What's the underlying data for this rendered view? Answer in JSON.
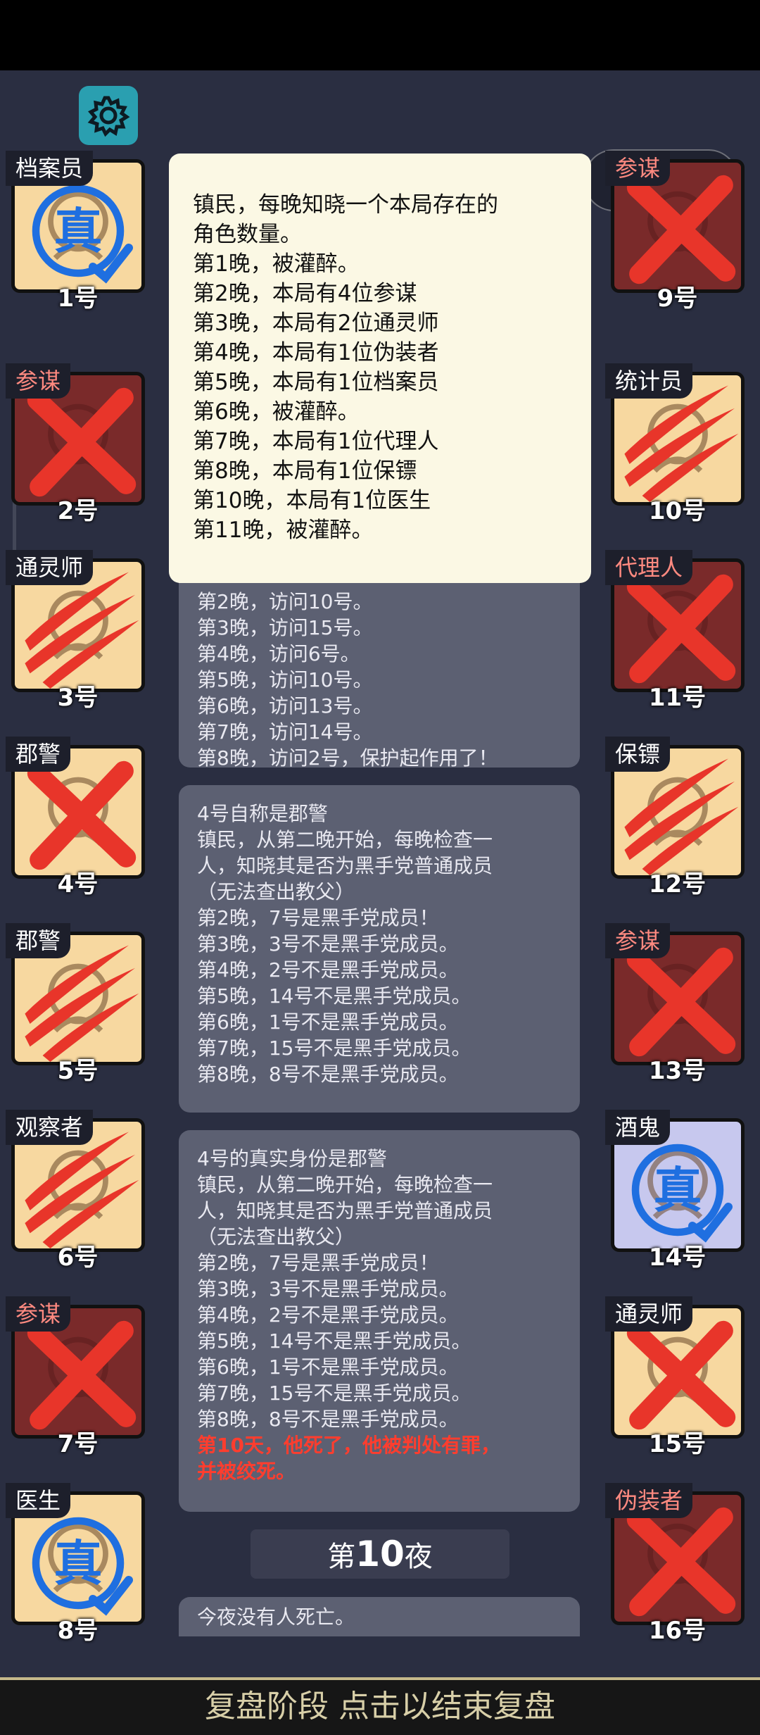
{
  "players_left": [
    {
      "num": "1号",
      "role": "档案员",
      "role_color": "white",
      "state": "true-seal"
    },
    {
      "num": "2号",
      "role": "参谋",
      "role_color": "red",
      "state": "dead-x"
    },
    {
      "num": "3号",
      "role": "通灵师",
      "role_color": "white",
      "state": "claw"
    },
    {
      "num": "4号",
      "role": "郡警",
      "role_color": "white",
      "state": "x"
    },
    {
      "num": "5号",
      "role": "郡警",
      "role_color": "white",
      "state": "claw"
    },
    {
      "num": "6号",
      "role": "观察者",
      "role_color": "white",
      "state": "claw"
    },
    {
      "num": "7号",
      "role": "参谋",
      "role_color": "red",
      "state": "dead-x"
    },
    {
      "num": "8号",
      "role": "医生",
      "role_color": "white",
      "state": "true-seal"
    }
  ],
  "players_right": [
    {
      "num": "9号",
      "role": "参谋",
      "role_color": "red",
      "state": "dead-x"
    },
    {
      "num": "10号",
      "role": "统计员",
      "role_color": "white",
      "state": "claw"
    },
    {
      "num": "11号",
      "role": "代理人",
      "role_color": "red",
      "state": "dead-x"
    },
    {
      "num": "12号",
      "role": "保镖",
      "role_color": "white",
      "state": "claw"
    },
    {
      "num": "13号",
      "role": "参谋",
      "role_color": "red",
      "state": "dead-x"
    },
    {
      "num": "14号",
      "role": "酒鬼",
      "role_color": "white",
      "state": "true-seal-lavender"
    },
    {
      "num": "15号",
      "role": "通灵师",
      "role_color": "white",
      "state": "x"
    },
    {
      "num": "16号",
      "role": "伪装者",
      "role_color": "red",
      "state": "dead-x"
    }
  ],
  "seal_char": "真",
  "popup": {
    "lines": [
      "镇民，每晚知晓一个本局存在的",
      "角色数量。",
      "第1晚，被灌醉。",
      "第2晚，本局有4位参谋",
      "第3晚，本局有2位通灵师",
      "第4晚，本局有1位伪装者",
      "第5晚，本局有1位档案员",
      "第6晚，被灌醉。",
      "第7晚，本局有1位代理人",
      "第8晚，本局有1位保镖",
      "第10晚，本局有1位医生",
      "第11晚，被灌醉。"
    ]
  },
  "log1": {
    "lines": [
      "第2晚，访问10号。",
      "第3晚，访问15号。",
      "第4晚，访问6号。",
      "第5晚，访问10号。",
      "第6晚，访问13号。",
      "第7晚，访问14号。",
      "第8晚，访问2号，保护起作用了！"
    ]
  },
  "log2": {
    "lines": [
      "4号自称是郡警",
      "镇民，从第二晚开始，每晚检查一",
      "人，知晓其是否为黑手党普通成员",
      "（无法查出教父）",
      "第2晚，7号是黑手党成员！",
      "第3晚，3号不是黑手党成员。",
      "第4晚，2号不是黑手党成员。",
      "第5晚，14号不是黑手党成员。",
      "第6晚，1号不是黑手党成员。",
      "第7晚，15号不是黑手党成员。",
      "第8晚，8号不是黑手党成员。"
    ]
  },
  "log3": {
    "lines": [
      "4号的真实身份是郡警",
      "镇民，从第二晚开始，每晚检查一",
      "人，知晓其是否为黑手党普通成员",
      "（无法查出教父）",
      "第2晚，7号是黑手党成员！",
      "第3晚，3号不是黑手党成员。",
      "第4晚，2号不是黑手党成员。",
      "第5晚，14号不是黑手党成员。",
      "第6晚，1号不是黑手党成员。",
      "第7晚，15号不是黑手党成员。",
      "第8晚，8号不是黑手党成员。"
    ],
    "death_lines": [
      "第10天，他死了，他被判处有罪，",
      "并被绞死。"
    ]
  },
  "night_header": {
    "prefix": "第",
    "number": "10",
    "suffix": "夜"
  },
  "log4": {
    "lines": [
      "今夜没有人死亡。"
    ]
  },
  "bottom_bar": "复盘阶段 点击以结束复盘",
  "colors": {
    "background": "#2a2e41",
    "dead_card": "#7a2a2a",
    "alive_card": "#f7d8a0",
    "x_red": "#e8352a",
    "seal_blue": "#1f6fe0",
    "death_text": "#ff3d2e"
  },
  "icons": {
    "settings": "gear-icon",
    "more": "more-dots-icon",
    "close": "close-circle-icon"
  }
}
